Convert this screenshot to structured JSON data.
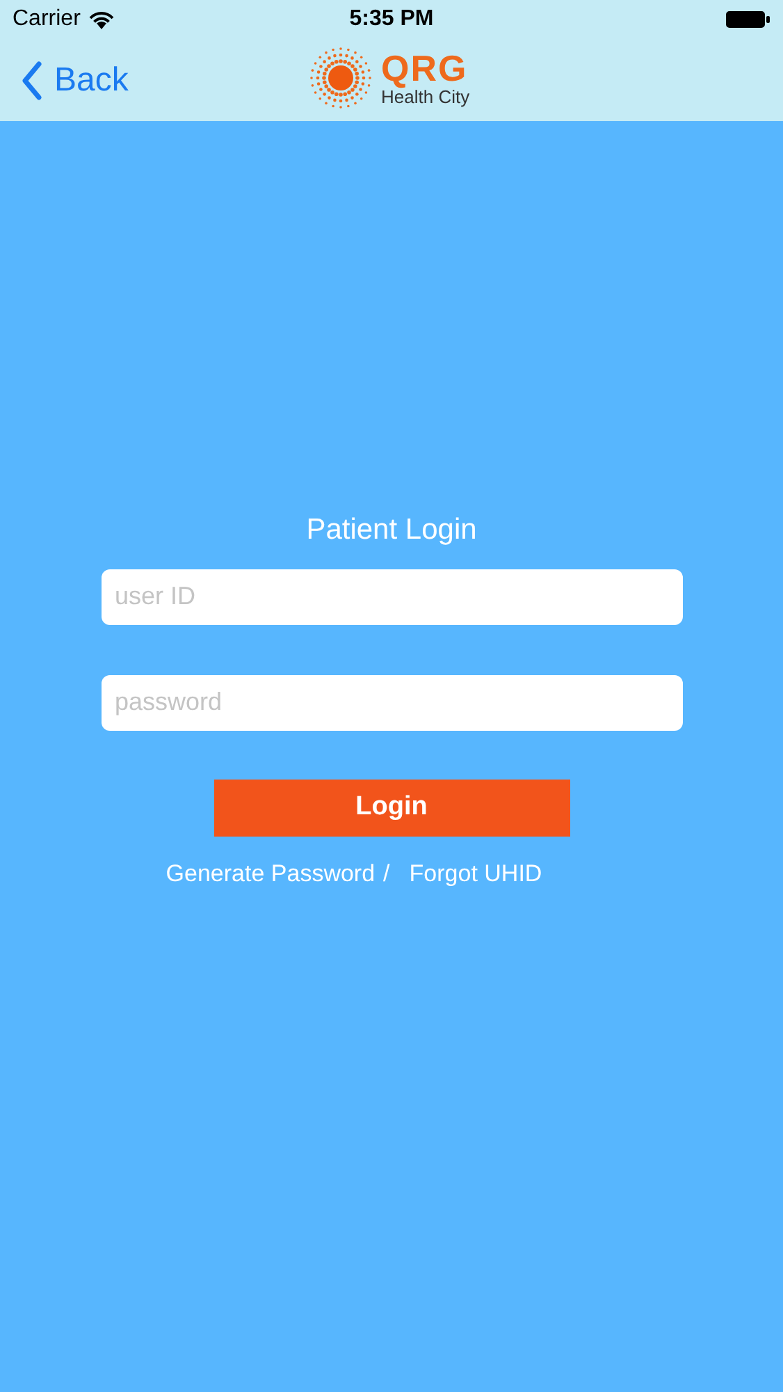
{
  "status_bar": {
    "carrier": "Carrier",
    "time": "5:35 PM"
  },
  "nav_bar": {
    "back": "Back",
    "logo": {
      "name": "QRG",
      "tagline": "Health City"
    }
  },
  "login": {
    "title": "Patient Login",
    "fields": [
      {
        "placeholder": "user ID"
      },
      {
        "placeholder": "password"
      }
    ],
    "button": "Login",
    "links": [
      {
        "kind": "link",
        "text": "Generate Password"
      },
      {
        "kind": "separator",
        "text": "/"
      },
      {
        "kind": "link",
        "text": "Forgot UHID"
      }
    ]
  }
}
